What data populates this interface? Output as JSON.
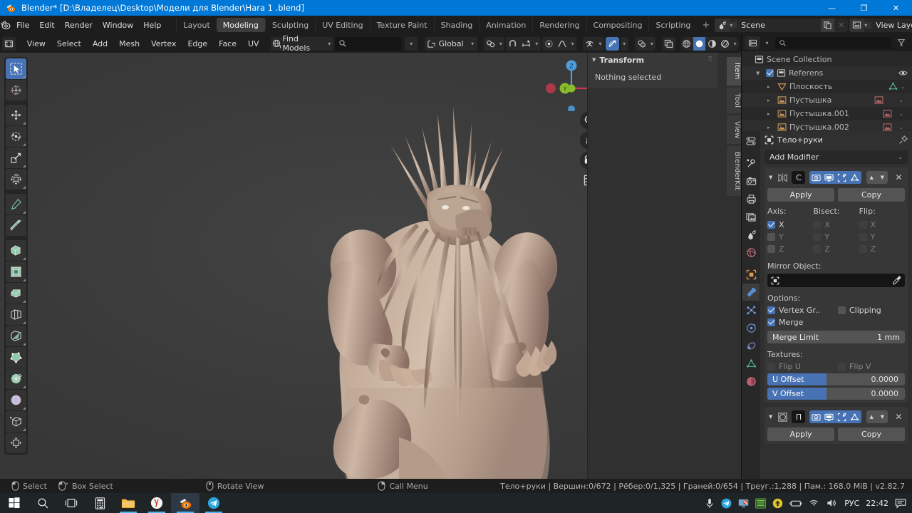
{
  "window": {
    "title": "Blender* [D:\\Владелец\\Desktop\\Модели для Blender\\Hara 1 .blend]",
    "minimize": "—",
    "maximize": "❐",
    "close": "✕"
  },
  "topbar": {
    "menus": [
      "File",
      "Edit",
      "Render",
      "Window",
      "Help"
    ],
    "workspaces": [
      {
        "label": "Layout",
        "active": false
      },
      {
        "label": "Modeling",
        "active": true
      },
      {
        "label": "Sculpting",
        "active": false
      },
      {
        "label": "UV Editing",
        "active": false
      },
      {
        "label": "Texture Paint",
        "active": false
      },
      {
        "label": "Shading",
        "active": false
      },
      {
        "label": "Animation",
        "active": false
      },
      {
        "label": "Rendering",
        "active": false
      },
      {
        "label": "Compositing",
        "active": false
      },
      {
        "label": "Scripting",
        "active": false
      }
    ],
    "add_workspace": "+",
    "scene_name": "Scene",
    "view_layer_name": "View Layer",
    "new_scene_icon": "duplicate-icon",
    "remove_scene_icon": "x-icon"
  },
  "viewport_header": {
    "mode_icon": "editmode-icon",
    "menus": [
      "View",
      "Select",
      "Add",
      "Mesh",
      "Vertex",
      "Edge",
      "Face",
      "UV"
    ],
    "find_models_label": "Find Models",
    "search_placeholder": "",
    "search_value": "",
    "transform_orientation": "Global",
    "snap_icon": "magnet-icon",
    "proportional_icon": "proportional-icon",
    "select_modes": [
      "vertex-select",
      "edge-select",
      "face-select"
    ],
    "shading_modes": [
      "wireframe",
      "solid",
      "material-preview",
      "rendered"
    ],
    "active_shading": "solid"
  },
  "toolbar": {
    "tools": [
      {
        "name": "tweak-select-box",
        "active": true
      },
      {
        "name": "cursor",
        "active": false
      },
      {
        "name": "move",
        "active": false
      },
      {
        "name": "rotate",
        "active": false
      },
      {
        "name": "scale",
        "active": false
      },
      {
        "name": "transform",
        "active": false
      },
      {
        "name": "annotate",
        "active": false
      },
      {
        "name": "measure",
        "active": false
      },
      {
        "name": "extrude-region",
        "active": false
      },
      {
        "name": "inset-faces",
        "active": false
      },
      {
        "name": "bevel",
        "active": false
      },
      {
        "name": "loop-cut",
        "active": false
      },
      {
        "name": "knife",
        "active": false
      },
      {
        "name": "poly-build",
        "active": false
      },
      {
        "name": "spin",
        "active": false
      },
      {
        "name": "smooth",
        "active": false
      },
      {
        "name": "shrink-fatten",
        "active": false
      },
      {
        "name": "shear",
        "active": false
      }
    ]
  },
  "gizmo": {
    "axes": [
      "Z",
      "Y",
      "X"
    ],
    "nav_buttons": [
      "zoom-icon",
      "pan-hand-icon",
      "camera-icon",
      "grid-ortho-icon"
    ]
  },
  "sidebar": {
    "panel_title": "Transform",
    "panel_body": "Nothing selected",
    "tabs": [
      {
        "label": "Item",
        "active": true
      },
      {
        "label": "Tool",
        "active": false
      },
      {
        "label": "View",
        "active": false
      },
      {
        "label": "BlenderKit",
        "active": false
      }
    ]
  },
  "outliner": {
    "display_mode_icon": "editor-type-icon",
    "filter_icon": "filter-icon",
    "search_placeholder": "",
    "root": "Scene Collection",
    "collection": {
      "name": "Referens",
      "checked": true,
      "visible_icon": "eye-icon"
    },
    "items": [
      {
        "name": "Плоскость",
        "icon": "mesh-triangle-icon",
        "data_icon": "mesh-data-icon"
      },
      {
        "name": "Пустышка",
        "icon": "image-empty-icon",
        "data_icon": "image-data-icon"
      },
      {
        "name": "Пустышка.001",
        "icon": "image-empty-icon",
        "data_icon": "image-data-icon"
      },
      {
        "name": "Пустышка.002",
        "icon": "image-empty-icon",
        "data_icon": "image-data-icon"
      }
    ]
  },
  "properties": {
    "tabs": [
      {
        "name": "tool-icon",
        "active": false
      },
      {
        "name": "render-icon",
        "active": false
      },
      {
        "name": "output-printer-icon",
        "active": false
      },
      {
        "name": "view-layer-icon",
        "active": false
      },
      {
        "name": "scene-icon",
        "active": false
      },
      {
        "name": "world-icon",
        "active": false
      },
      {
        "name": "object-icon",
        "active": false
      },
      {
        "name": "modifier-wrench-icon",
        "active": true
      },
      {
        "name": "particles-icon",
        "active": false
      },
      {
        "name": "physics-icon",
        "active": false
      },
      {
        "name": "constraints-icon",
        "active": false
      },
      {
        "name": "object-data-icon",
        "active": false
      },
      {
        "name": "material-icon",
        "active": false
      }
    ],
    "breadcrumb_object": "Тело+руки",
    "add_modifier": "Add Modifier",
    "modifiers": [
      {
        "expand_icon": "triangle-down-icon",
        "type_icon": "mirror-modifier-icon",
        "name": "C",
        "display_toggles": [
          "on-cage",
          "edit-mode",
          "realtime",
          "render"
        ],
        "apply": "Apply",
        "copy": "Copy",
        "columns": [
          {
            "label": "Axis:",
            "dim": false,
            "rows": [
              {
                "label": "X",
                "checked": true,
                "dim": false
              },
              {
                "label": "Y",
                "checked": false,
                "dim": false
              },
              {
                "label": "Z",
                "checked": false,
                "dim": false
              }
            ]
          },
          {
            "label": "Bisect:",
            "dim": false,
            "rows": [
              {
                "label": "X",
                "checked": false,
                "dim": true
              },
              {
                "label": "Y",
                "checked": false,
                "dim": true
              },
              {
                "label": "Z",
                "checked": false,
                "dim": true
              }
            ]
          },
          {
            "label": "Flip:",
            "dim": false,
            "rows": [
              {
                "label": "X",
                "checked": false,
                "dim": true
              },
              {
                "label": "Y",
                "checked": false,
                "dim": true
              },
              {
                "label": "Z",
                "checked": false,
                "dim": true
              }
            ]
          }
        ],
        "mirror_object_label": "Mirror Object:",
        "mirror_object_value": "",
        "options_label": "Options:",
        "vertex_group_label": "Vertex Gr..",
        "vertex_group_checked": true,
        "clipping_label": "Clipping",
        "clipping_checked": false,
        "merge_label": "Merge",
        "merge_checked": true,
        "merge_limit_label": "Merge Limit",
        "merge_limit_value": "1 mm",
        "textures_label": "Textures:",
        "flip_u_label": "Flip U",
        "flip_v_label": "Flip V",
        "u_offset_label": "U Offset",
        "u_offset_value": "0.0000",
        "v_offset_label": "V Offset",
        "v_offset_value": "0.0000"
      },
      {
        "expand_icon": "triangle-down-icon",
        "type_icon": "subsurf-modifier-icon",
        "name": "П",
        "apply": "Apply",
        "copy": "Copy"
      }
    ]
  },
  "statusbar": {
    "hints": [
      {
        "icon": "mouse-left-icon",
        "label": "Select"
      },
      {
        "icon": "mouse-left-drag-icon",
        "label": "Box Select"
      },
      {
        "icon": "mouse-middle-icon",
        "label": "Rotate View"
      },
      {
        "icon": "mouse-right-icon",
        "label": "Call Menu"
      }
    ],
    "stats": "Тело+руки  | Вершин:0/672 | Рёбер:0/1,325 | Граней:0/654 | Треуг.:1,288 | Пам.: 168.0 MiB | v2.82.7"
  },
  "taskbar": {
    "buttons": [
      {
        "name": "start-windows-icon"
      },
      {
        "name": "search-icon"
      },
      {
        "name": "task-view-icon"
      },
      {
        "name": "calculator-icon"
      },
      {
        "name": "file-explorer-icon",
        "open": true
      },
      {
        "name": "yandex-browser-icon",
        "open": true
      },
      {
        "name": "blender-icon",
        "active": true
      },
      {
        "name": "telegram-icon",
        "open": true
      }
    ],
    "tray": [
      {
        "name": "microphone-icon"
      },
      {
        "name": "telegram-tray-icon"
      },
      {
        "name": "display-block-icon"
      },
      {
        "name": "equalizer-icon"
      },
      {
        "name": "update-icon"
      },
      {
        "name": "battery-icon"
      },
      {
        "name": "wifi-icon"
      },
      {
        "name": "volume-icon"
      }
    ],
    "language": "РУС",
    "clock": "22:42",
    "notifications_icon": "notifications-icon"
  },
  "colors": {
    "accent_blue": "#4772b3",
    "title_blue": "#0078d7",
    "viewport_bg": "#3d3d3d",
    "panel_bg": "#303030",
    "header_bg": "#1d1d1d",
    "model_base": "#c0a694"
  }
}
